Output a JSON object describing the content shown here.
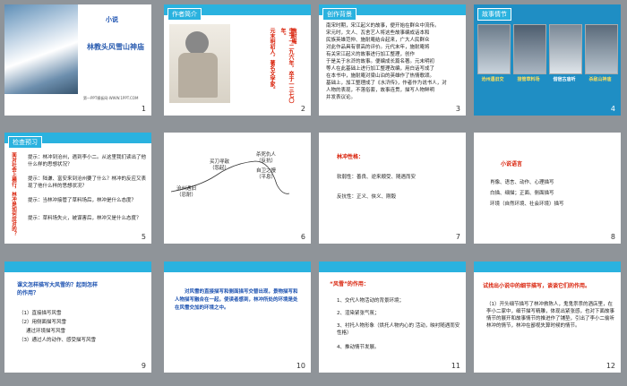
{
  "s1": {
    "num": "1",
    "tag": "小说",
    "title": "林教头风雪山神庙",
    "foot": "第一PPT模板网-WWW.1PPT.COM"
  },
  "s2": {
    "num": "2",
    "tag": "作者简介",
    "col1": "施耐庵",
    "col2": "生于一二九六年，卒于一三七〇年。",
    "col3": "元末明初人，著名文学家。"
  },
  "s3": {
    "num": "3",
    "tag": "创作背景",
    "lines": [
      "南宋时期，宋江起义的故事，便开始在群众中流传。",
      "宋元时，文人、瓦舍艺人将这些故事编成话本和",
      "民族英雄范仲、施耐庵结合起来，广大人民群众",
      "对此作品具有很高的评价。元代末年，施耐庵将",
      "有关宋江起义的故事进行加工整理，创作",
      "于是关于水浒的故事。便编成长篇名著。元末明初",
      "等人在此基础上进行加工整理改编，用白话写成了",
      "在本书中，施耐庵对梁山泊的英雄作了热情歌颂。",
      "基础上，加工整理成了《水浒传》，作者作为说书人，对",
      "人物的表现，不落俗套，故事连贯，描写人物鲜明",
      "并发表议论。"
    ]
  },
  "s4": {
    "num": "4",
    "tag": "故事情节",
    "caps": [
      "沧州遇旧交",
      "接管草料场",
      "借宿古庙听",
      "杀敌山神庙"
    ]
  },
  "s5": {
    "num": "5",
    "tag": "检查预习",
    "side": "面对社会上横行，林冲是如何应对的？",
    "q": [
      "提示：林冲到沧州，遇到李小二。从这里我们读出了他什么样的思想状况？",
      "提示：陆谦、富安来到沧州要了什么？林冲的反应又表现了他什么样的思想状况？",
      "提示：当林冲接管了草料场后，林冲是什么态度？",
      "提示：草料场失火，被谋害后，林冲又是什么态度？"
    ]
  },
  "s6": {
    "num": "6",
    "nodes": {
      "a": "沧州遇旧",
      "a2": "（忍耐）",
      "b": "买刀寻敌",
      "b2": "（怨起）",
      "c": "杀死仇人",
      "c2": "（反抗）",
      "d": "自卫之慢",
      "d2": "（平息）"
    }
  },
  "s7": {
    "num": "7",
    "title": "林冲性格：",
    "l1": "软弱性：善良、逆来顺受、随遇而安",
    "l2": "反抗性：正义、侠义、刚毅"
  },
  "s8": {
    "num": "8",
    "title": "小说语言",
    "l1": "肖像、语言、动作、心理描写",
    "l2": "白描、细描；正面、侧面描写",
    "l3": "环境（自然环境、社会环境）描写"
  },
  "s9": {
    "num": "9",
    "q": "课文怎样描写大风雪的？起到怎样的作用？",
    "items": [
      "（1）直接描写风雪",
      "（2）用侧面描写风雪",
      "通过环境描写风雪",
      "（3）通过人的动作、感受描写风雪"
    ]
  },
  "s10": {
    "num": "10",
    "text": "对风雪的直接描写和侧面描写交替出现，景物描写和人物描写融合在一起，使读者感到，林冲所处的环境是处在风雪交加的环境之中。"
  },
  "s11": {
    "num": "11",
    "title": "“风雪”的作用：",
    "items": [
      "1、交代人物活动的背景环境；",
      "2、渲染紧张气氛；",
      "3、衬托人物形象（烘托人物内心的 活动，映衬随遇而安性格）",
      "4、推动情节发展。"
    ]
  },
  "s12": {
    "num": "12",
    "title": "试找出小说中的细节描写，谈谈它们的作用。",
    "text": "（1）开头细节描写了林冲救陈人，鬼鬼祟祟的酒店里，在李小二家中，细节描写精雕，体现出紧张感，也对下面故事情节的展开和故事情节的推进作了铺垫，引出了李小二偷听林冲的情节，林冲在鄙视失算时候的情节。"
  }
}
